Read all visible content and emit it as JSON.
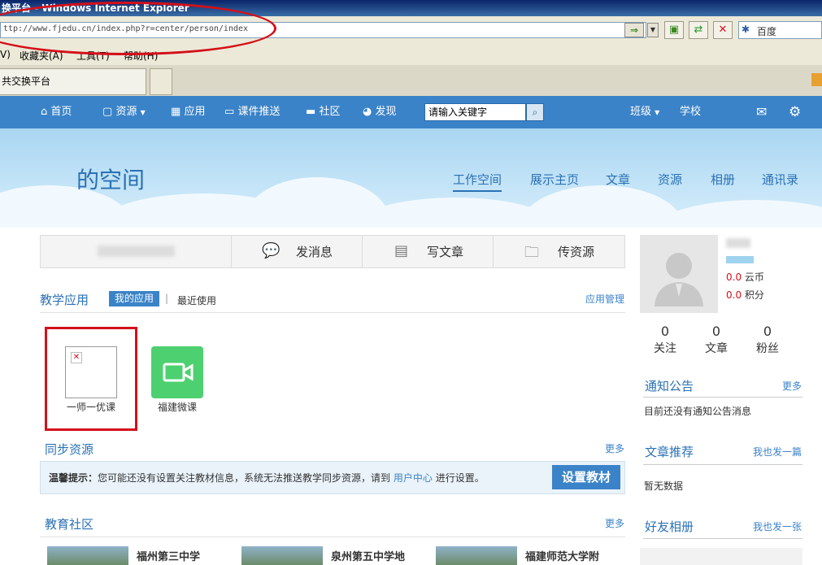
{
  "browser": {
    "title": "换平台 - Windows Internet Explorer",
    "address": "ttp://www.fjedu.cn/index.php?r=center/person/index",
    "search_engine": "百度",
    "menu": [
      "V)",
      "收藏夹(A)",
      "工具(T)",
      "帮助(H)"
    ],
    "tab_label": "共交换平台"
  },
  "nav": {
    "items": [
      "首页",
      "资源",
      "应用",
      "课件推送",
      "社区",
      "发现"
    ],
    "search_placeholder": "请输入关键字",
    "right_items": [
      "班级",
      "学校"
    ]
  },
  "banner": {
    "title": "的空间",
    "tabs": [
      "工作空间",
      "展示主页",
      "文章",
      "资源",
      "相册",
      "通讯录"
    ]
  },
  "actions": [
    "发消息",
    "写文章",
    "传资源"
  ],
  "teaching_apps": {
    "title": "教学应用",
    "tab_mine": "我的应用",
    "tab_recent": "最近使用",
    "manage": "应用管理",
    "apps": [
      "一师一优课",
      "福建微课"
    ]
  },
  "sync_resources": {
    "title": "同步资源",
    "more": "更多",
    "tip_label": "温馨提示：",
    "tip_text": "您可能还没有设置关注教材信息，系统无法推送教学同步资源，请到",
    "tip_link": "用户中心",
    "tip_after": "进行设置。",
    "button": "设置教材"
  },
  "community": {
    "title": "教育社区",
    "more": "更多",
    "schools": [
      "福州第三中学",
      "泉州第五中学地",
      "福建师范大学附"
    ]
  },
  "profile": {
    "coins_value": "0.0",
    "coins_label": "云币",
    "points_value": "0.0",
    "points_label": "积分",
    "stats": [
      {
        "value": "0",
        "label": "关注"
      },
      {
        "value": "0",
        "label": "文章"
      },
      {
        "value": "0",
        "label": "粉丝"
      }
    ]
  },
  "notice": {
    "title": "通知公告",
    "more": "更多",
    "text": "目前还没有通知公告消息"
  },
  "articles": {
    "title": "文章推荐",
    "action": "我也发一篇",
    "text": "暂无数据"
  },
  "albums": {
    "title": "好友相册",
    "action": "我也发一张"
  }
}
